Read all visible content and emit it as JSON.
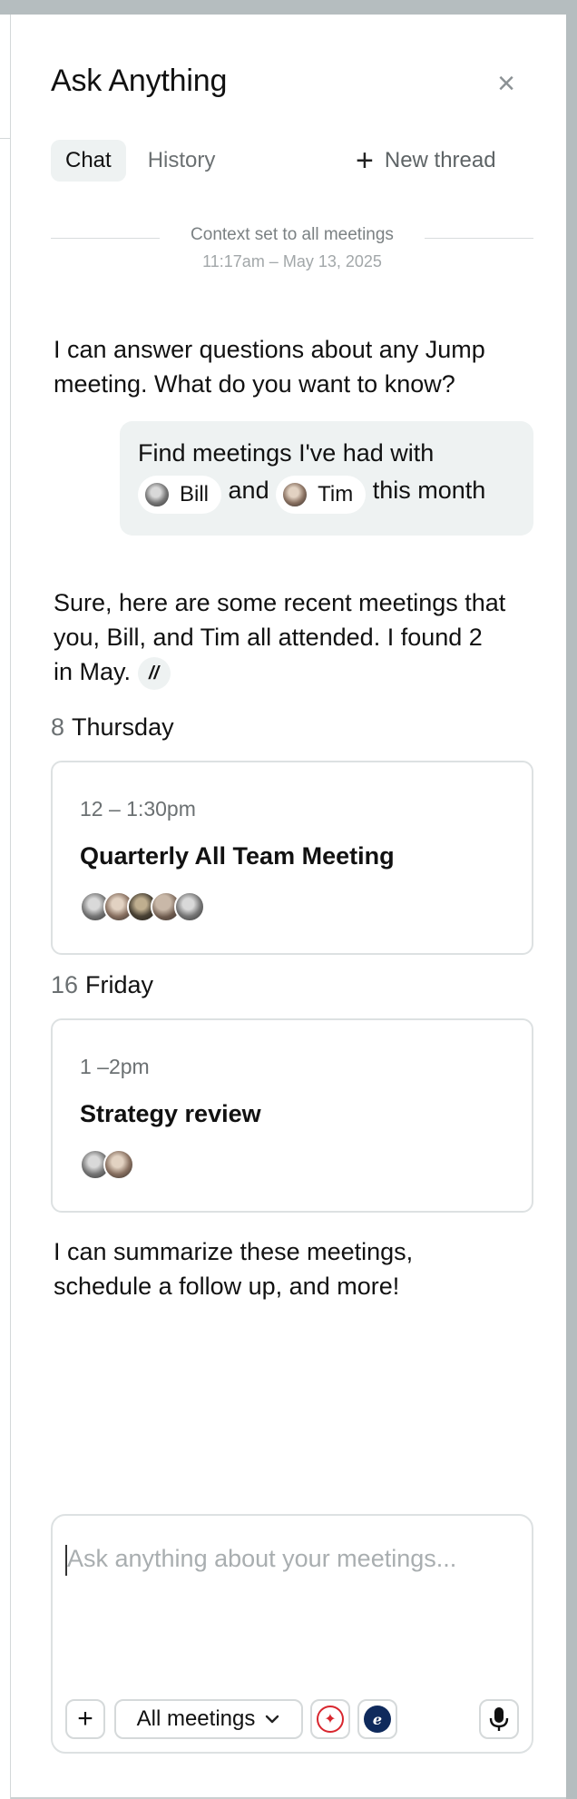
{
  "title": "Ask Anything",
  "close_icon": "×",
  "tabs": [
    {
      "label": "Chat",
      "active": true
    },
    {
      "label": "History",
      "active": false
    }
  ],
  "new_thread": {
    "icon": "+",
    "label": "New thread"
  },
  "context": {
    "text": "Context set to all meetings",
    "time": "11:17am – May 13, 2025"
  },
  "messages": {
    "assistant_intro": "I can answer questions about any Jump meeting. What do you want to know?",
    "user": {
      "prefix": "Find meetings I've had with",
      "person1": "Bill",
      "and": "and",
      "person2": "Tim",
      "suffix": "this month"
    },
    "assistant_reply": "Sure, here are some recent meetings that you, Bill, and Tim all attended. I found 2 in May.",
    "jump_icon": "//",
    "assistant_outro": "I can summarize these meetings, schedule a follow up, and more!"
  },
  "days": [
    {
      "num": "8",
      "name": "Thursday",
      "meeting": {
        "time": "12 – 1:30pm",
        "title": "Quarterly All Team Meeting",
        "attendee_count": 5
      }
    },
    {
      "num": "16",
      "name": "Friday",
      "meeting": {
        "time": "1 –2pm",
        "title": "Strategy review",
        "attendee_count": 2
      }
    }
  ],
  "composer": {
    "placeholder": "Ask anything about your meetings...",
    "add_icon": "+",
    "filter_label": "All meetings",
    "filter_icon": "chevron-down-icon",
    "integration_icons": [
      "red-integration-icon",
      "blue-integration-icon"
    ],
    "mic_icon": "microphone-icon"
  },
  "colors": {
    "background": "#b5bdbf",
    "panel": "#ffffff",
    "bubble": "#eef2f2",
    "border": "#dde1e2",
    "muted_text": "#6b7072"
  }
}
